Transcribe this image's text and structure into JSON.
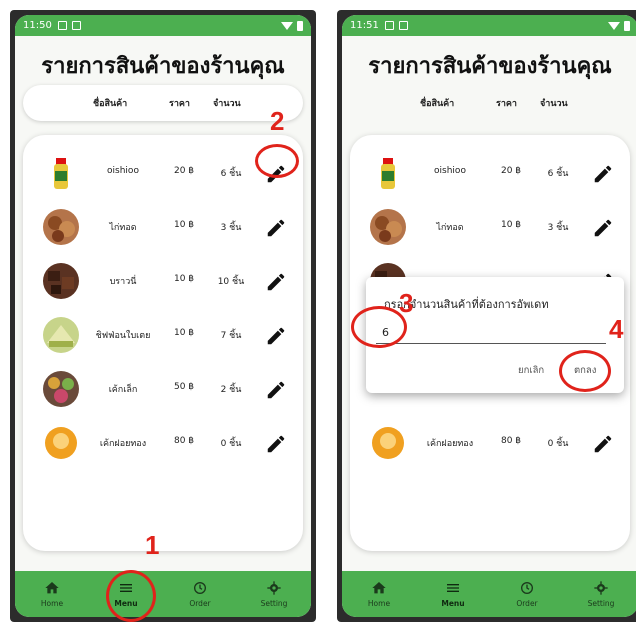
{
  "status": {
    "left_time": "11:50",
    "right_time": "11:51"
  },
  "screen": {
    "title": "รายการสินค้าของร้านคุณ",
    "columns": {
      "name": "ชื่อสินค้า",
      "price": "ราคา",
      "qty": "จำนวน"
    }
  },
  "products_left": [
    {
      "name": "oishioo",
      "price": "20 ฿",
      "qty": "6 ชิ้น",
      "thumb": "drink-bottle"
    },
    {
      "name": "ไก่ทอด",
      "price": "10 ฿",
      "qty": "3 ชิ้น",
      "thumb": "fried-chicken"
    },
    {
      "name": "บราวนี่",
      "price": "10 ฿",
      "qty": "10 ชิ้น",
      "thumb": "brownie"
    },
    {
      "name": "ชิฟฟ่อนใบเตย",
      "price": "10 ฿",
      "qty": "7 ชิ้น",
      "thumb": "pandan-chiffon"
    },
    {
      "name": "เค้กเล็ก",
      "price": "50 ฿",
      "qty": "2 ชิ้น",
      "thumb": "small-cake"
    },
    {
      "name": "เค้กฝอยทอง",
      "price": "80 ฿",
      "qty": "0 ชิ้น",
      "thumb": "foi-thong-cake"
    }
  ],
  "products_right": [
    {
      "name": "oishioo",
      "price": "20 ฿",
      "qty": "6 ชิ้น"
    },
    {
      "name": "ไก่ทอด",
      "price": "10 ฿",
      "qty": "3 ชิ้น"
    },
    {
      "name": "เค้กฝอยทอง",
      "price": "80 ฿",
      "qty": "0 ชิ้น"
    }
  ],
  "dialog": {
    "title": "กรอกจำนวนสินค้าที่ต้องการอัพเดท",
    "value": "6",
    "cancel": "ยกเลิก",
    "ok": "ตกลง"
  },
  "nav": [
    {
      "label": "Home",
      "icon": "home-icon"
    },
    {
      "label": "Menu",
      "icon": "menu-icon"
    },
    {
      "label": "Order",
      "icon": "history-icon"
    },
    {
      "label": "Setting",
      "icon": "gear-icon"
    }
  ],
  "annotations": {
    "step1": "1",
    "step2": "2",
    "step3": "3",
    "step4": "4"
  },
  "colors": {
    "accent": "#4caf50",
    "annotation": "#e0231b"
  }
}
